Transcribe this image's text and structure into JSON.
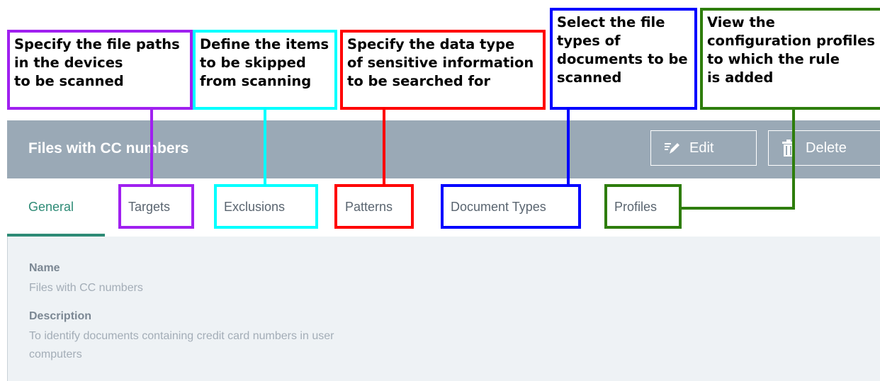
{
  "header": {
    "title": "Files with CC numbers",
    "edit_label": "Edit",
    "delete_label": "Delete"
  },
  "tabs": [
    {
      "label": "General",
      "active": true
    },
    {
      "label": "Targets"
    },
    {
      "label": "Exclusions"
    },
    {
      "label": "Patterns"
    },
    {
      "label": "Document Types"
    },
    {
      "label": "Profiles"
    }
  ],
  "general": {
    "name_label": "Name",
    "name_value": "Files with CC numbers",
    "description_label": "Description",
    "description_line1": "To identify documents containing credit card numbers in user",
    "description_line2": "computers"
  },
  "callouts": {
    "targets": {
      "color": "#a020f0",
      "lines": [
        "Specify the file paths",
        "in the devices",
        "to be scanned"
      ]
    },
    "exclusions": {
      "color": "#00ffff",
      "lines": [
        "Define the items",
        "to be skipped",
        "from scanning"
      ]
    },
    "patterns": {
      "color": "#ff0000",
      "lines": [
        "Specify the data type",
        "of sensitive information",
        "to be searched for"
      ]
    },
    "document_types": {
      "color": "#0000ff",
      "lines": [
        "Select the file",
        "types of",
        "documents to be",
        "scanned"
      ]
    },
    "profiles": {
      "color": "#2e7d0c",
      "lines": [
        "View the",
        "configuration profiles",
        "to which the rule",
        "is added"
      ]
    }
  },
  "colors": {
    "header_bg": "#9aa9b6",
    "accent": "#2e8b76",
    "content_bg": "#eef2f5"
  },
  "icons": {
    "edit": "edit-pencil-icon",
    "delete": "trash-icon"
  }
}
